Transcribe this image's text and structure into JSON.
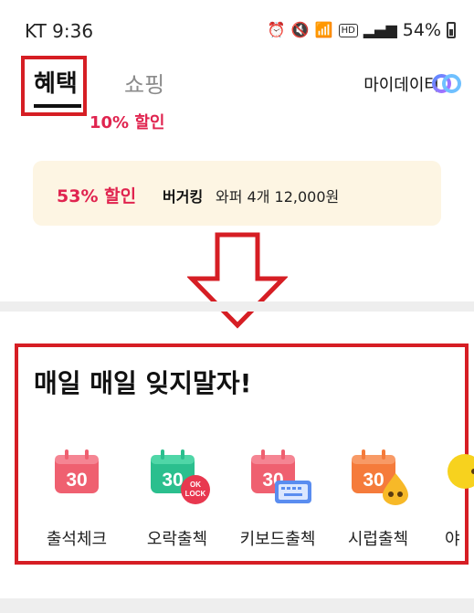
{
  "status_bar": {
    "carrier_time": "KT 9:36",
    "hd": "HD",
    "battery": "54%"
  },
  "tabs": {
    "benefit": "혜택",
    "shopping": "쇼핑",
    "discount_badge": "10% 할인"
  },
  "header": {
    "mydata_label": "마이데이터"
  },
  "banner": {
    "discount": "53% 할인",
    "brand": "버거킹",
    "description": "와퍼 4개 12,000원"
  },
  "section": {
    "title": "매일 매일 잊지말자!",
    "items": [
      {
        "label": "출석체크",
        "day": "30",
        "badge": ""
      },
      {
        "label": "오락출첵",
        "day": "30",
        "badge": "OK LOCK"
      },
      {
        "label": "키보드출첵",
        "day": "30",
        "badge": ""
      },
      {
        "label": "시럽출첵",
        "day": "30",
        "badge": ""
      },
      {
        "label": "야",
        "day": "",
        "badge": ""
      }
    ]
  },
  "colors": {
    "accent_red": "#e0244f",
    "highlight_border": "#d61e24",
    "banner_bg": "#fdf5e3"
  }
}
